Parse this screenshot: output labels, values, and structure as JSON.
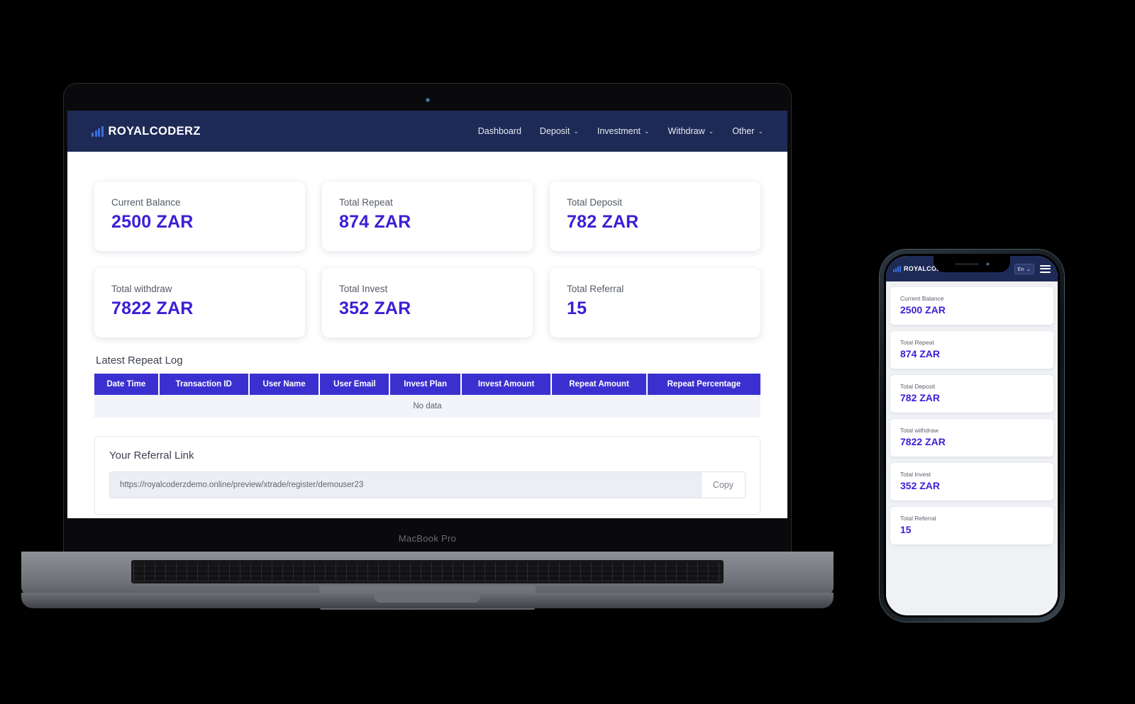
{
  "device": {
    "laptop_label": "MacBook Pro"
  },
  "navbar": {
    "logo_text": "ROYALCODERZ",
    "links": [
      {
        "label": "Dashboard",
        "caret": ""
      },
      {
        "label": "Deposit",
        "caret": "⌄"
      },
      {
        "label": "Investment",
        "caret": "⌄"
      },
      {
        "label": "Withdraw",
        "caret": "⌄"
      },
      {
        "label": "Other",
        "caret": "⌄"
      }
    ]
  },
  "stats": [
    {
      "label": "Current Balance",
      "value": "2500 ZAR"
    },
    {
      "label": "Total Repeat",
      "value": "874 ZAR"
    },
    {
      "label": "Total Deposit",
      "value": "782 ZAR"
    },
    {
      "label": "Total withdraw",
      "value": "7822 ZAR"
    },
    {
      "label": "Total Invest",
      "value": "352 ZAR"
    },
    {
      "label": "Total Referral",
      "value": "15"
    }
  ],
  "repeat_log": {
    "title": "Latest Repeat Log",
    "columns": [
      "Date Time",
      "Transaction ID",
      "User Name",
      "User Email",
      "Invest Plan",
      "Invest Amount",
      "Repeat Amount",
      "Repeat Percentage"
    ],
    "empty_text": "No data"
  },
  "referral": {
    "title": "Your Referral Link",
    "url": "https://royalcoderzdemo.online/preview/xtrade/register/demouser23",
    "copy_label": "Copy"
  },
  "phone": {
    "logo_text": "ROYALCODERZ",
    "language": "En",
    "language_caret": "⌄",
    "cards": [
      {
        "label": "Current Balance",
        "value": "2500 ZAR"
      },
      {
        "label": "Total Repeat",
        "value": "874 ZAR"
      },
      {
        "label": "Total Deposit",
        "value": "782 ZAR"
      },
      {
        "label": "Total withdraw",
        "value": "7822 ZAR"
      },
      {
        "label": "Total Invest",
        "value": "352 ZAR"
      },
      {
        "label": "Total Referral",
        "value": "15"
      }
    ]
  },
  "colors": {
    "navbar": "#1e2a56",
    "accent_value": "#3a1fd6",
    "table_header": "#3b30cf",
    "logo_bar": "#3b6fe0"
  }
}
